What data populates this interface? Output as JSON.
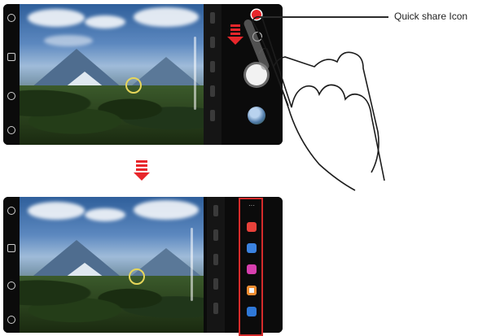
{
  "callout": {
    "label": "Quick share Icon"
  },
  "icons": {
    "timer": "timer-icon",
    "flash": "flash-icon",
    "mode": "mode-icon",
    "settings": "settings-icon",
    "quick_share": "quick-share-icon",
    "switch_camera": "switch-camera-icon",
    "shutter": "shutter-button",
    "gallery": "gallery-thumbnail"
  },
  "share_apps": [
    "red-app-icon",
    "blue-app-icon",
    "pink-app-icon",
    "orange-app-icon",
    "blue-chat-app-icon"
  ],
  "colors": {
    "accent_red": "#e8262b",
    "focus_yellow": "#e6d65a"
  }
}
